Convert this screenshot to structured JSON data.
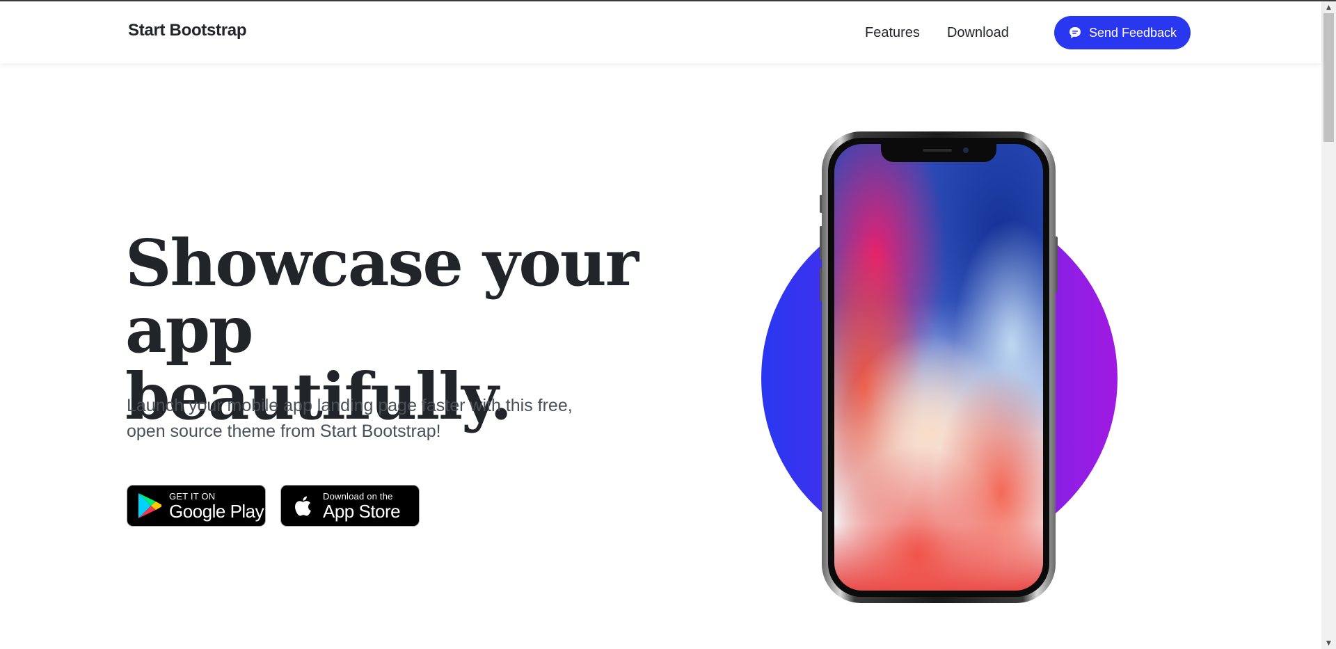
{
  "navbar": {
    "brand": "Start Bootstrap",
    "links": [
      "Features",
      "Download"
    ],
    "feedback_button": "Send Feedback"
  },
  "hero": {
    "title_line1": "Showcase your",
    "title_line2": "app beautifully.",
    "lead": "Launch your mobile app landing page faster with this free, open source theme from Start Bootstrap!"
  },
  "badges": {
    "google_play": {
      "small": "GET IT ON",
      "big": "Google Play"
    },
    "app_store": {
      "small": "Download on the",
      "big": "App Store"
    }
  },
  "colors": {
    "accent": "#2937f0",
    "gradient_start": "#2937f0",
    "gradient_end": "#9f1ae2",
    "text": "#212529",
    "muted_text": "#495057"
  },
  "icons": {
    "feedback": "chat-bubble-icon",
    "google_play": "google-play-icon",
    "app_store": "apple-icon"
  }
}
